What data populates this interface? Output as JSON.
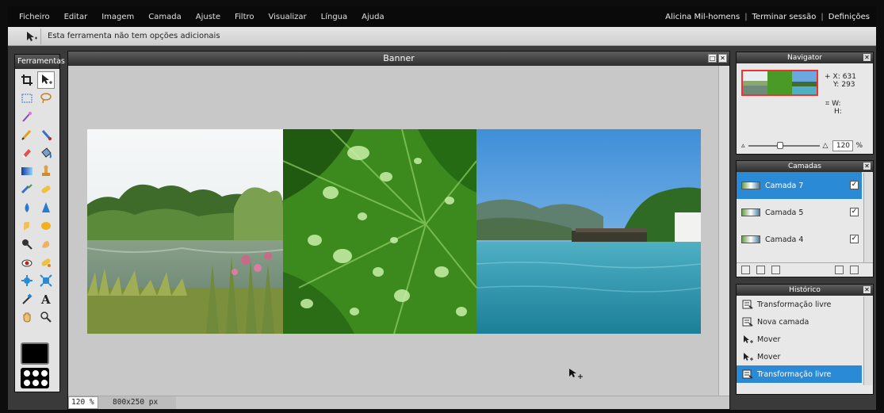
{
  "menubar": {
    "items": [
      "Ficheiro",
      "Editar",
      "Imagem",
      "Camada",
      "Ajuste",
      "Filtro",
      "Visualizar",
      "Língua",
      "Ajuda"
    ],
    "user_name": "Alicina Mil-homens",
    "logout": "Terminar sessão",
    "settings": "Definições"
  },
  "options_bar": {
    "message": "Esta ferramenta não tem opções adicionais"
  },
  "toolbox": {
    "title": "Ferramentas",
    "tools": [
      "crop-icon",
      "move-icon",
      "marquee-icon",
      "lasso-icon",
      "magic-wand-icon",
      "",
      "pencil-icon",
      "brush-icon",
      "eraser-icon",
      "fill-bucket-icon",
      "gradient-icon",
      "clone-stamp-icon",
      "color-replace-icon",
      "heal-icon",
      "blur-icon",
      "sharpen-icon",
      "smudge-icon",
      "sponge-icon",
      "dodge-icon",
      "burn-icon",
      "red-eye-icon",
      "spot-heal-icon",
      "bloat-icon",
      "pinch-icon",
      "color-picker-icon",
      "text-icon",
      "hand-icon",
      "zoom-icon"
    ],
    "primary_color": "#000000"
  },
  "document": {
    "title": "Banner",
    "zoom": "120 %",
    "size": "800x250 px"
  },
  "navigator": {
    "title": "Navigator",
    "x_label": "X:",
    "x_value": "631",
    "y_label": "Y:",
    "y_value": "293",
    "w_label": "W:",
    "h_label": "H:",
    "zoom_value": "120",
    "zoom_unit": "%"
  },
  "layers": {
    "title": "Camadas",
    "items": [
      {
        "name": "Camada 7",
        "visible": "✓"
      },
      {
        "name": "Camada 5",
        "visible": "✓"
      },
      {
        "name": "Camada 4",
        "visible": "✓"
      }
    ]
  },
  "history": {
    "title": "Histórico",
    "items": [
      "Transformação livre",
      "Nova camada",
      "Mover",
      "Mover",
      "Transformação livre"
    ]
  },
  "colors": {
    "selection": "#2a8ad6",
    "panel_header": "#2d2d2d"
  }
}
